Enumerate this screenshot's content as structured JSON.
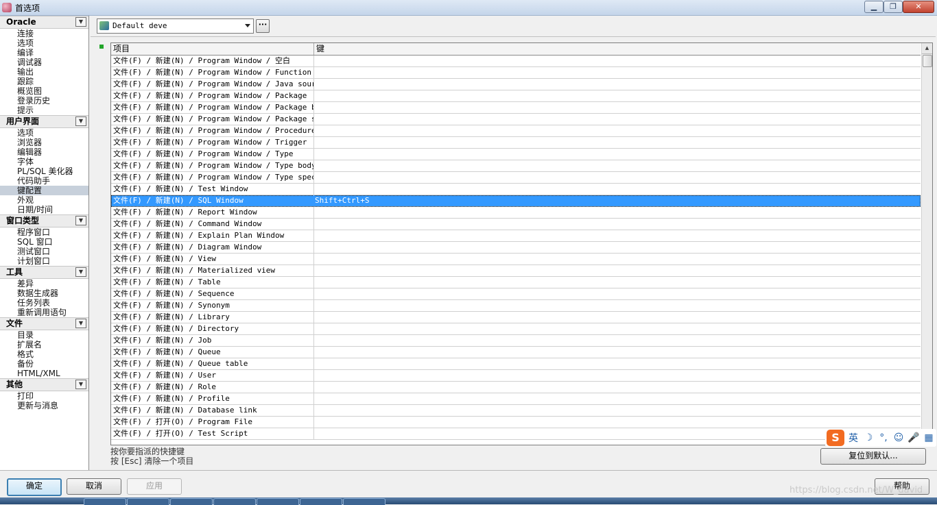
{
  "window": {
    "title": "首选项"
  },
  "titlebar": {
    "minimize": "▁",
    "maximize": "❐",
    "close": "✕"
  },
  "nav": {
    "sections": [
      {
        "header": "Oracle",
        "items": [
          "连接",
          "选项",
          "编译",
          "调试器",
          "输出",
          "跟踪",
          "概览图",
          "登录历史",
          "提示"
        ]
      },
      {
        "header": "用户界面",
        "items": [
          "选项",
          "浏览器",
          "编辑器",
          "字体",
          "PL/SQL 美化器",
          "代码助手",
          "键配置",
          "外观",
          "日期/时间"
        ]
      },
      {
        "header": "窗口类型",
        "items": [
          "程序窗口",
          "SQL 窗口",
          "测试窗口",
          "计划窗口"
        ]
      },
      {
        "header": "工具",
        "items": [
          "差异",
          "数据生成器",
          "任务列表",
          "重新调用语句"
        ]
      },
      {
        "header": "文件",
        "items": [
          "目录",
          "扩展名",
          "格式",
          "备份",
          "HTML/XML"
        ]
      },
      {
        "header": "其他",
        "items": [
          "打印",
          "更新与消息"
        ]
      }
    ],
    "selected": "键配置",
    "chevron": "▼"
  },
  "toolbar": {
    "profile_value": "Default deve",
    "more_label": "···"
  },
  "grid": {
    "headers": {
      "item": "项目",
      "key": "键"
    },
    "rows": [
      [
        "文件(F) / 新建(N) / Program Window / 空白",
        ""
      ],
      [
        "文件(F) / 新建(N) / Program Window / Function",
        ""
      ],
      [
        "文件(F) / 新建(N) / Program Window / Java source",
        ""
      ],
      [
        "文件(F) / 新建(N) / Program Window / Package",
        ""
      ],
      [
        "文件(F) / 新建(N) / Program Window / Package body",
        ""
      ],
      [
        "文件(F) / 新建(N) / Program Window / Package spec",
        ""
      ],
      [
        "文件(F) / 新建(N) / Program Window / Procedure",
        ""
      ],
      [
        "文件(F) / 新建(N) / Program Window / Trigger",
        ""
      ],
      [
        "文件(F) / 新建(N) / Program Window / Type",
        ""
      ],
      [
        "文件(F) / 新建(N) / Program Window / Type body",
        ""
      ],
      [
        "文件(F) / 新建(N) / Program Window / Type specifi",
        ""
      ],
      [
        "文件(F) / 新建(N) / Test Window",
        ""
      ],
      [
        "文件(F) / 新建(N) / SQL Window",
        "Shift+Ctrl+S"
      ],
      [
        "文件(F) / 新建(N) / Report Window",
        ""
      ],
      [
        "文件(F) / 新建(N) / Command Window",
        ""
      ],
      [
        "文件(F) / 新建(N) / Explain Plan Window",
        ""
      ],
      [
        "文件(F) / 新建(N) / Diagram Window",
        ""
      ],
      [
        "文件(F) / 新建(N) / View",
        ""
      ],
      [
        "文件(F) / 新建(N) / Materialized view",
        ""
      ],
      [
        "文件(F) / 新建(N) / Table",
        ""
      ],
      [
        "文件(F) / 新建(N) / Sequence",
        ""
      ],
      [
        "文件(F) / 新建(N) / Synonym",
        ""
      ],
      [
        "文件(F) / 新建(N) / Library",
        ""
      ],
      [
        "文件(F) / 新建(N) / Directory",
        ""
      ],
      [
        "文件(F) / 新建(N) / Job",
        ""
      ],
      [
        "文件(F) / 新建(N) / Queue",
        ""
      ],
      [
        "文件(F) / 新建(N) / Queue table",
        ""
      ],
      [
        "文件(F) / 新建(N) / User",
        ""
      ],
      [
        "文件(F) / 新建(N) / Role",
        ""
      ],
      [
        "文件(F) / 新建(N) / Profile",
        ""
      ],
      [
        "文件(F) / 新建(N) / Database link",
        ""
      ],
      [
        "文件(F) / 打开(O) / Program File",
        ""
      ],
      [
        "文件(F) / 打开(O) / Test Script",
        ""
      ]
    ],
    "selected_row": 12
  },
  "hints": {
    "line1": "按你要指派的快捷键",
    "line2": "按 [Esc] 清除一个项目"
  },
  "buttons": {
    "reset": "复位到默认...",
    "ok": "确定",
    "cancel": "取消",
    "apply": "应用",
    "help": "帮助"
  },
  "ime": {
    "logo": "S",
    "lang": "英",
    "icons": [
      "☽",
      "°,",
      "☺",
      "🎤",
      "▦"
    ]
  },
  "watermark": "https://blog.csdn.net/W_david"
}
